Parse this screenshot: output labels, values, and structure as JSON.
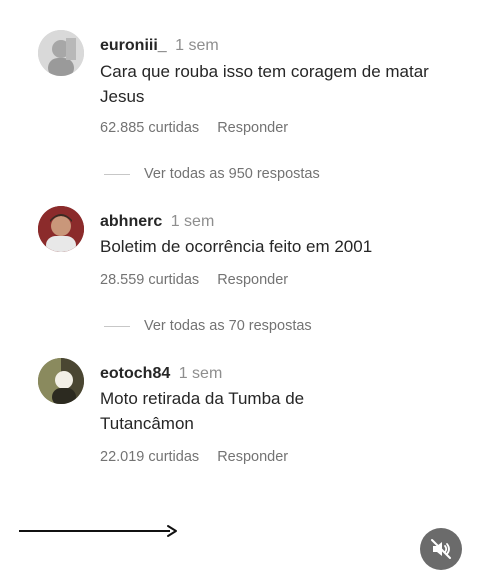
{
  "comments": [
    {
      "username": "euroniii_",
      "time": "1 sem",
      "text": "Cara que rouba isso tem coragem de matar Jesus",
      "likes": "62.885 curtidas",
      "reply": "Responder",
      "view_replies": "Ver todas as 950 respostas"
    },
    {
      "username": "abhnerc",
      "time": "1 sem",
      "text": "Boletim de ocorrência feito em 2001",
      "likes": "28.559 curtidas",
      "reply": "Responder",
      "view_replies": "Ver todas as 70 respostas"
    },
    {
      "username": "eotoch84",
      "time": "1 sem",
      "text": "Moto retirada da Tumba de Tutancâmon",
      "likes": "22.019 curtidas",
      "reply": "Responder"
    }
  ],
  "icons": {
    "arrow": "arrow-right-icon",
    "mute": "speaker-muted-icon"
  },
  "colors": {
    "text": "#262626",
    "secondary": "#737373",
    "mute_button": "#6b6b6b"
  }
}
